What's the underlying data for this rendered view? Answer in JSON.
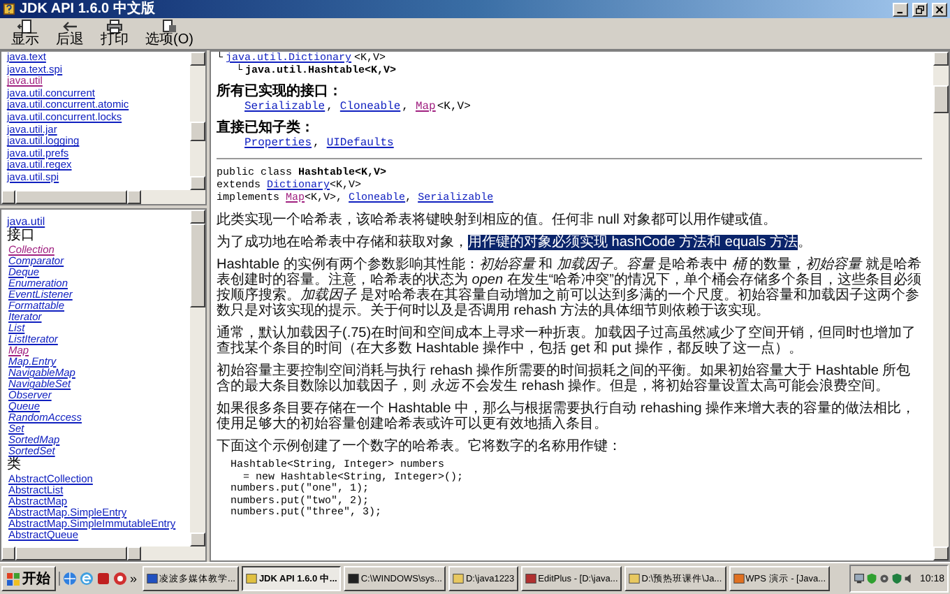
{
  "window": {
    "title": "JDK API 1.6.0 中文版"
  },
  "toolbar": [
    {
      "kind": "show",
      "label": "显示"
    },
    {
      "kind": "back",
      "label": "后退"
    },
    {
      "kind": "print",
      "label": "打印"
    },
    {
      "kind": "options",
      "label": "选项(O)"
    }
  ],
  "package_list": [
    {
      "label": "java.text",
      "visited": false
    },
    {
      "label": "java.text.spi",
      "visited": false
    },
    {
      "label": "java.util",
      "visited": true
    },
    {
      "label": "java.util.concurrent",
      "visited": false
    },
    {
      "label": "java.util.concurrent.atomic",
      "visited": false
    },
    {
      "label": "java.util.concurrent.locks",
      "visited": false
    },
    {
      "label": "java.util.jar",
      "visited": false
    },
    {
      "label": "java.util.logging",
      "visited": false
    },
    {
      "label": "java.util.prefs",
      "visited": false
    },
    {
      "label": "java.util.regex",
      "visited": false
    },
    {
      "label": "java.util.spi",
      "visited": false
    }
  ],
  "class_list": {
    "package": "java.util",
    "sections": [
      {
        "kind": "interface",
        "title": "接口",
        "items": [
          {
            "label": "Collection",
            "visited": true
          },
          {
            "label": "Comparator",
            "visited": false
          },
          {
            "label": "Deque",
            "visited": false
          },
          {
            "label": "Enumeration",
            "visited": false
          },
          {
            "label": "EventListener",
            "visited": false
          },
          {
            "label": "Formattable",
            "visited": false
          },
          {
            "label": "Iterator",
            "visited": false
          },
          {
            "label": "List",
            "visited": false
          },
          {
            "label": "ListIterator",
            "visited": false
          },
          {
            "label": "Map",
            "visited": true
          },
          {
            "label": "Map.Entry",
            "visited": false
          },
          {
            "label": "NavigableMap",
            "visited": false
          },
          {
            "label": "NavigableSet",
            "visited": false
          },
          {
            "label": "Observer",
            "visited": false
          },
          {
            "label": "Queue",
            "visited": false
          },
          {
            "label": "RandomAccess",
            "visited": false
          },
          {
            "label": "Set",
            "visited": false
          },
          {
            "label": "SortedMap",
            "visited": false
          },
          {
            "label": "SortedSet",
            "visited": false
          }
        ]
      },
      {
        "kind": "class",
        "title": "类",
        "items": [
          {
            "label": "AbstractCollection",
            "visited": false
          },
          {
            "label": "AbstractList",
            "visited": false
          },
          {
            "label": "AbstractMap",
            "visited": false
          },
          {
            "label": "AbstractMap.SimpleEntry",
            "visited": false
          },
          {
            "label": "AbstractMap.SimpleImmutableEntry",
            "visited": false
          },
          {
            "label": "AbstractQueue",
            "visited": false
          }
        ]
      }
    ]
  },
  "document": {
    "hierarchy": {
      "glyph": "└",
      "label": "java.util.Dictionary",
      "suffix": "<K,V>",
      "kind": "link",
      "children": [
        {
          "glyph": "└",
          "label": "java.util.Hashtable<K,V>",
          "kind": "current"
        }
      ]
    },
    "sections": [
      {
        "title": "所有已实现的接口：",
        "links": [
          {
            "label": "Serializable",
            "suffix": ",",
            "visited": false
          },
          {
            "label": "Cloneable",
            "suffix": ",",
            "visited": false
          },
          {
            "label": "Map",
            "suffix": "<K,V>",
            "visited": true
          }
        ]
      },
      {
        "title": "直接已知子类：",
        "links": [
          {
            "label": "Properties",
            "suffix": ",",
            "visited": false
          },
          {
            "label": "UIDefaults",
            "visited": false
          }
        ]
      }
    ],
    "declaration": [
      {
        "segments": [
          {
            "text": "public class ",
            "kind": "plain"
          },
          {
            "text": "Hashtable<K,V>",
            "kind": "bold"
          }
        ]
      },
      {
        "segments": [
          {
            "text": "extends ",
            "kind": "plain"
          },
          {
            "text": "Dictionary",
            "kind": "link"
          },
          {
            "text": "<K,V>",
            "kind": "plain"
          }
        ]
      },
      {
        "segments": [
          {
            "text": "implements ",
            "kind": "plain"
          },
          {
            "text": "Map",
            "kind": "visited"
          },
          {
            "text": "<K,V>, ",
            "kind": "plain"
          },
          {
            "text": "Cloneable",
            "kind": "link"
          },
          {
            "text": ", ",
            "kind": "plain"
          },
          {
            "text": "Serializable",
            "kind": "link"
          }
        ]
      }
    ],
    "paragraphs": [
      {
        "segments": [
          {
            "text": "此类实现一个哈希表，该哈希表将键映射到相应的值。任何非 null 对象都可以用作键或值。",
            "selected": false
          }
        ]
      },
      {
        "segments": [
          {
            "text": "为了成功地在哈希表中存储和获取对象，",
            "selected": false
          },
          {
            "text": "用作键的对象必须实现 hashCode 方法和 equals 方法",
            "selected": true
          },
          {
            "text": "。",
            "selected": false
          }
        ]
      },
      {
        "segments": [
          {
            "text": "Hashtable 的实例有两个参数影响其性能：*初始容量* 和 *加载因子*。*容量* 是哈希表中 *桶* 的数量，*初始容量* 就是哈希表创建时的容量。注意，哈希表的状态为 *open* 在发生“哈希冲突”的情况下，单个桶会存储多个条目，这些条目必须按顺序搜索。*加载因子* 是对哈希表在其容量自动增加之前可以达到多满的一个尺度。初始容量和加载因子这两个参数只是对该实现的提示。关于何时以及是否调用 rehash 方法的具体细节则依赖于该实现。",
            "selected": false
          }
        ]
      },
      {
        "segments": [
          {
            "text": "通常，默认加载因子(.75)在时间和空间成本上寻求一种折衷。加载因子过高虽然减少了空间开销，但同时也增加了查找某个条目的时间（在大多数 Hashtable 操作中，包括 get 和 put 操作，都反映了这一点）。",
            "selected": false
          }
        ]
      },
      {
        "segments": [
          {
            "text": "初始容量主要控制空间消耗与执行 rehash 操作所需要的时间损耗之间的平衡。如果初始容量大于 Hashtable 所包含的最大条目数除以加载因子，则 *永远* 不会发生 rehash 操作。但是，将初始容量设置太高可能会浪费空间。",
            "selected": false
          }
        ]
      },
      {
        "segments": [
          {
            "text": "如果很多条目要存储在一个 Hashtable 中，那么与根据需要执行自动 rehashing 操作来增大表的容量的做法相比，使用足够大的初始容量创建哈希表或许可以更有效地插入条目。",
            "selected": false
          }
        ]
      },
      {
        "segments": [
          {
            "text": "下面这个示例创建了一个数字的哈希表。它将数字的名称用作键：",
            "selected": false
          }
        ]
      }
    ],
    "code": [
      "Hashtable<String, Integer> numbers",
      "  = new Hashtable<String, Integer>();",
      "numbers.put(\"one\", 1);",
      "numbers.put(\"two\", 2);",
      "numbers.put(\"three\", 3);"
    ]
  },
  "taskbar": {
    "start": "开始",
    "more": "»",
    "tasks": [
      {
        "kind": "teaching",
        "label": "凌波多媒体教学...",
        "selected": false
      },
      {
        "kind": "help",
        "label": "JDK API 1.6.0 中...",
        "selected": true
      },
      {
        "kind": "console",
        "label": "C:\\WINDOWS\\sys...",
        "selected": false
      },
      {
        "kind": "folder",
        "label": "D:\\java1223",
        "selected": false
      },
      {
        "kind": "editor",
        "label": "EditPlus - [D:\\java...",
        "selected": false
      },
      {
        "kind": "folder",
        "label": "D:\\预热班课件\\Ja...",
        "selected": false
      },
      {
        "kind": "slides",
        "label": "WPS 演示 - [Java...",
        "selected": false
      }
    ],
    "clock": "10:18"
  }
}
